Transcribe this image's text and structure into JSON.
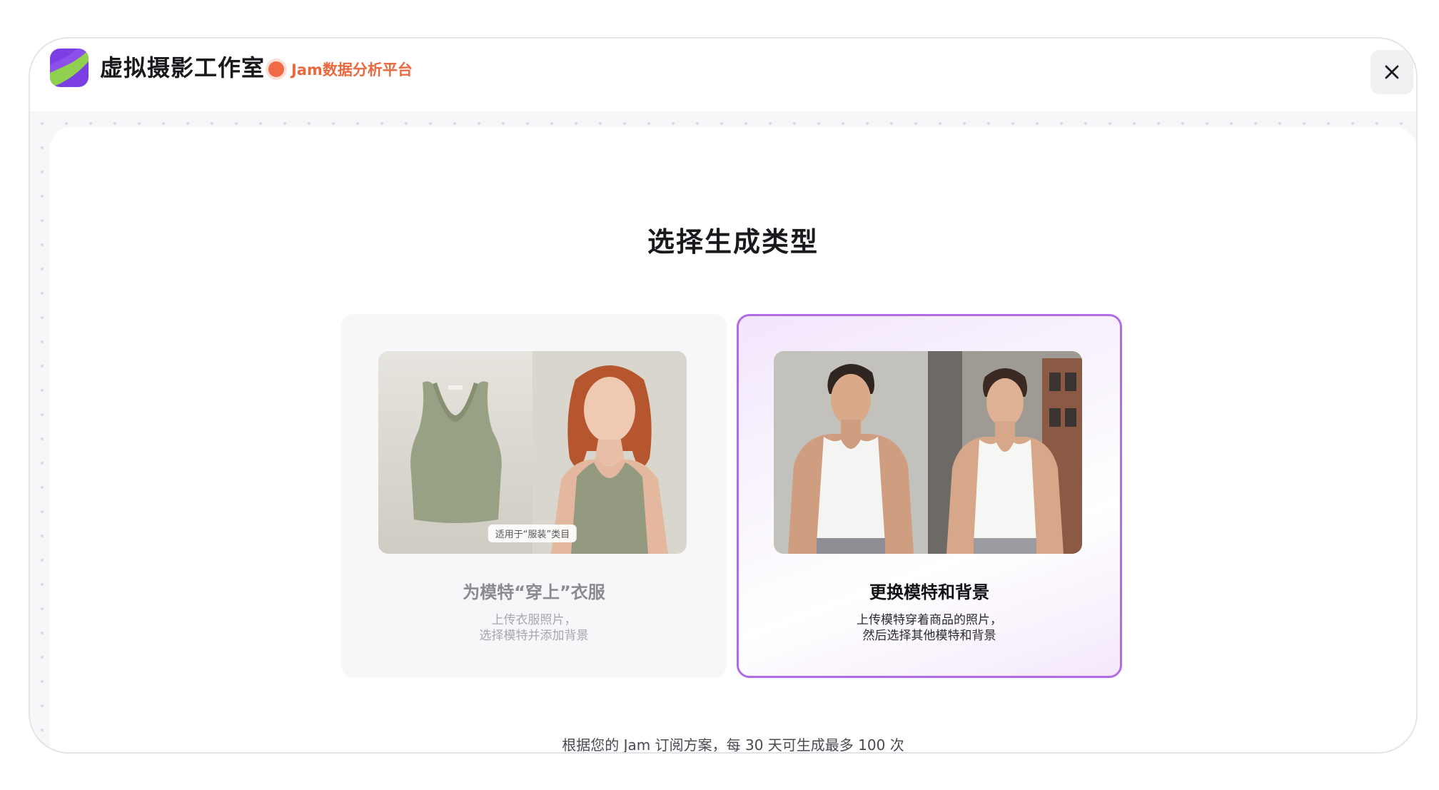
{
  "app": {
    "title": "虚拟摄影工作室",
    "platform_label": "Jam数据分析平台",
    "close_icon": "close-icon"
  },
  "colors": {
    "accent_purple": "#b06ce6",
    "platform_orange": "#e8683f",
    "logo_purple": "#7b3fe4",
    "logo_green": "#8fd14f"
  },
  "main": {
    "heading": "选择生成类型",
    "cards": [
      {
        "title": "为模特“穿上”衣服",
        "desc_line1": "上传衣服照片，",
        "desc_line2": "选择模特并添加背景",
        "image_label": "适用于“服装”类目",
        "selected": false
      },
      {
        "title": "更换模特和背景",
        "desc_line1": "上传模特穿着商品的照片，",
        "desc_line2": "然后选择其他模特和背景",
        "selected": true
      }
    ],
    "footer_note": "根据您的 Jam 订阅方案，每 30 天可生成最多 100 次"
  }
}
